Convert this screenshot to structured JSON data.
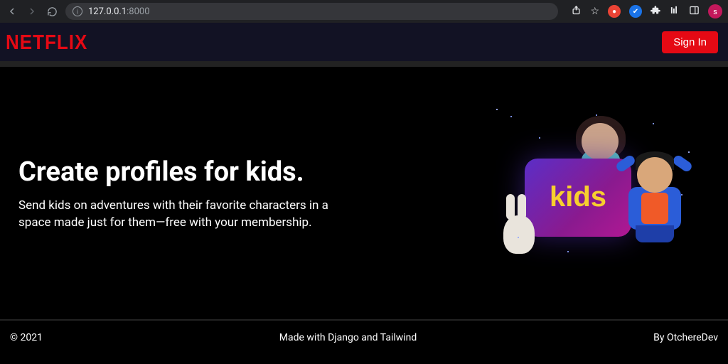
{
  "browser": {
    "url_host": "127.0.0.1",
    "url_port": ":8000",
    "avatar_initial": "s"
  },
  "header": {
    "logo_text": "NETFLIX",
    "sign_in_label": "Sign In"
  },
  "hero": {
    "title": "Create profiles for kids.",
    "subtitle": "Send kids on adventures with their favorite characters in a space made just for them—free with your membership.",
    "kids_tile_label": "kids"
  },
  "footer": {
    "copyright": "© 2021",
    "made_with": "Made with Django and Tailwind",
    "author": "By OtchereDev"
  }
}
